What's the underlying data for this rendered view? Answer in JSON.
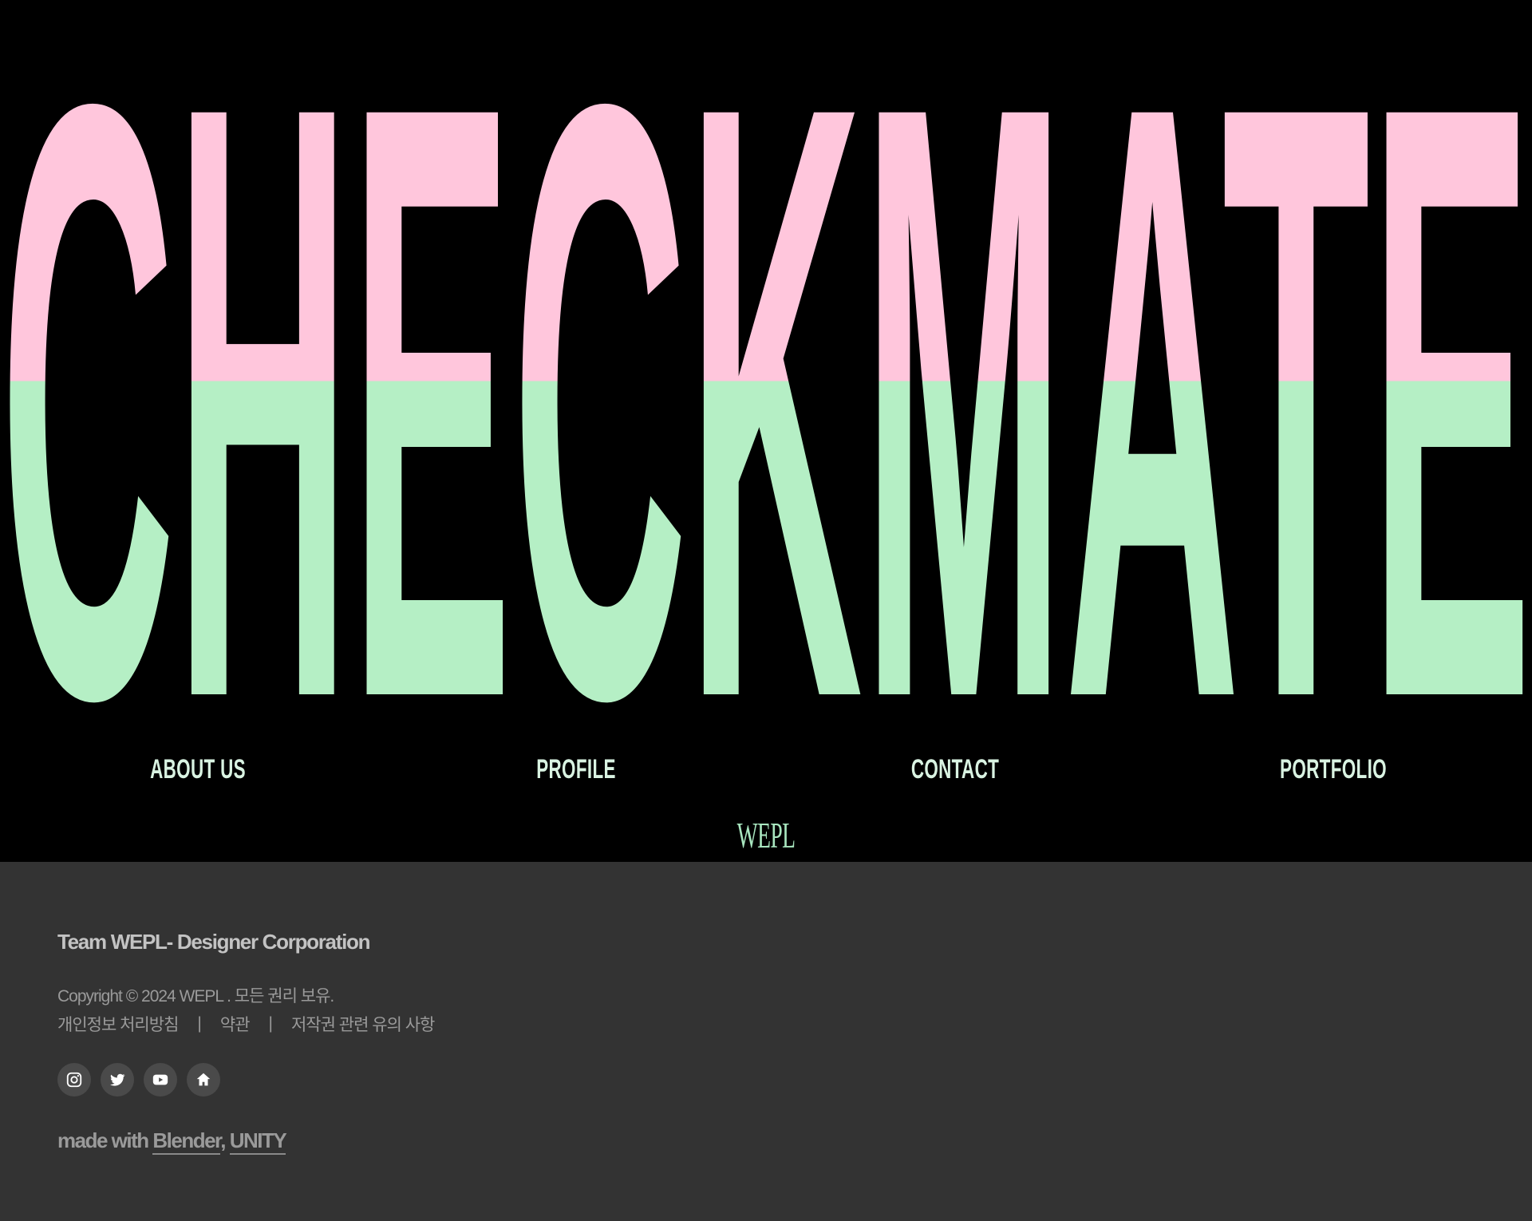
{
  "hero": {
    "title": "CHECKMATE",
    "colors": {
      "top": "#ffc6dc",
      "bottom": "#b5efc5",
      "background": "#000000"
    }
  },
  "nav": {
    "items": [
      {
        "label": "ABOUT US"
      },
      {
        "label": "PROFILE"
      },
      {
        "label": "CONTACT"
      },
      {
        "label": "PORTFOLIO"
      }
    ]
  },
  "brand": {
    "logo": "WEPL"
  },
  "footer": {
    "company": "Team WEPL- Designer Corporation",
    "copyright": "Copyright © 2024 WEPL . 모든 권리 보유.",
    "links": [
      {
        "label": "개인정보 처리방침"
      },
      {
        "label": "약관"
      },
      {
        "label": "저작권 관련 유의 사항"
      }
    ],
    "separator": "|",
    "social": [
      {
        "icon": "instagram-icon"
      },
      {
        "icon": "twitter-icon"
      },
      {
        "icon": "youtube-icon"
      },
      {
        "icon": "home-icon"
      }
    ],
    "made_with": {
      "prefix": "made with",
      "tools": [
        "Blender",
        "UNITY"
      ],
      "joiner": ","
    }
  }
}
